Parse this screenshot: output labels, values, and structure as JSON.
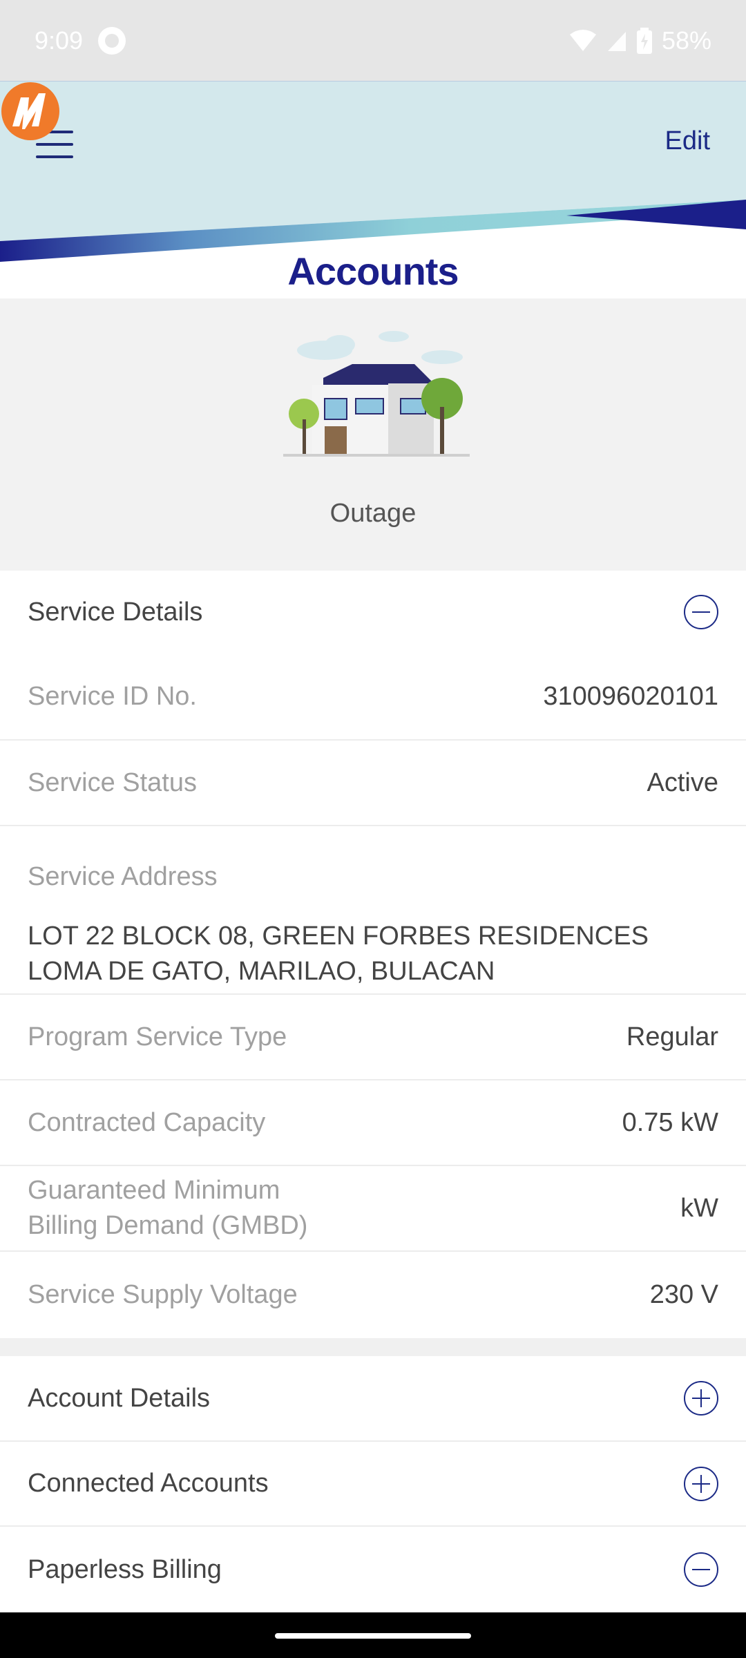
{
  "status_bar": {
    "time": "9:09",
    "battery": "58%"
  },
  "header": {
    "edit_label": "Edit",
    "title": "Accounts"
  },
  "hero": {
    "label": "Outage"
  },
  "service_details": {
    "title": "Service Details",
    "rows": [
      {
        "label": "Service ID No.",
        "value": "310096020101"
      },
      {
        "label": "Service Status",
        "value": "Active"
      }
    ],
    "address_label": "Service Address",
    "address_lines": [
      "LOT 22 BLOCK 08, GREEN FORBES RESIDENCES",
      "LOMA DE GATO, MARILAO, BULACAN"
    ],
    "rows2": [
      {
        "label": "Program Service Type",
        "value": "Regular"
      },
      {
        "label": "Contracted Capacity",
        "value": "0.75 kW"
      }
    ],
    "gmbd_label_line1": "Guaranteed Minimum",
    "gmbd_label_line2": "Billing Demand (GMBD)",
    "gmbd_value": "kW",
    "voltage_label": "Service Supply Voltage",
    "voltage_value": "230 V"
  },
  "sections": [
    {
      "title": "Account Details",
      "state": "collapsed"
    },
    {
      "title": "Connected Accounts",
      "state": "collapsed"
    },
    {
      "title": "Paperless Billing",
      "state": "expanded"
    }
  ],
  "colors": {
    "accent": "#1b2a86",
    "brand_orange": "#f07a2a",
    "header_bg": "#d3e8ec"
  }
}
